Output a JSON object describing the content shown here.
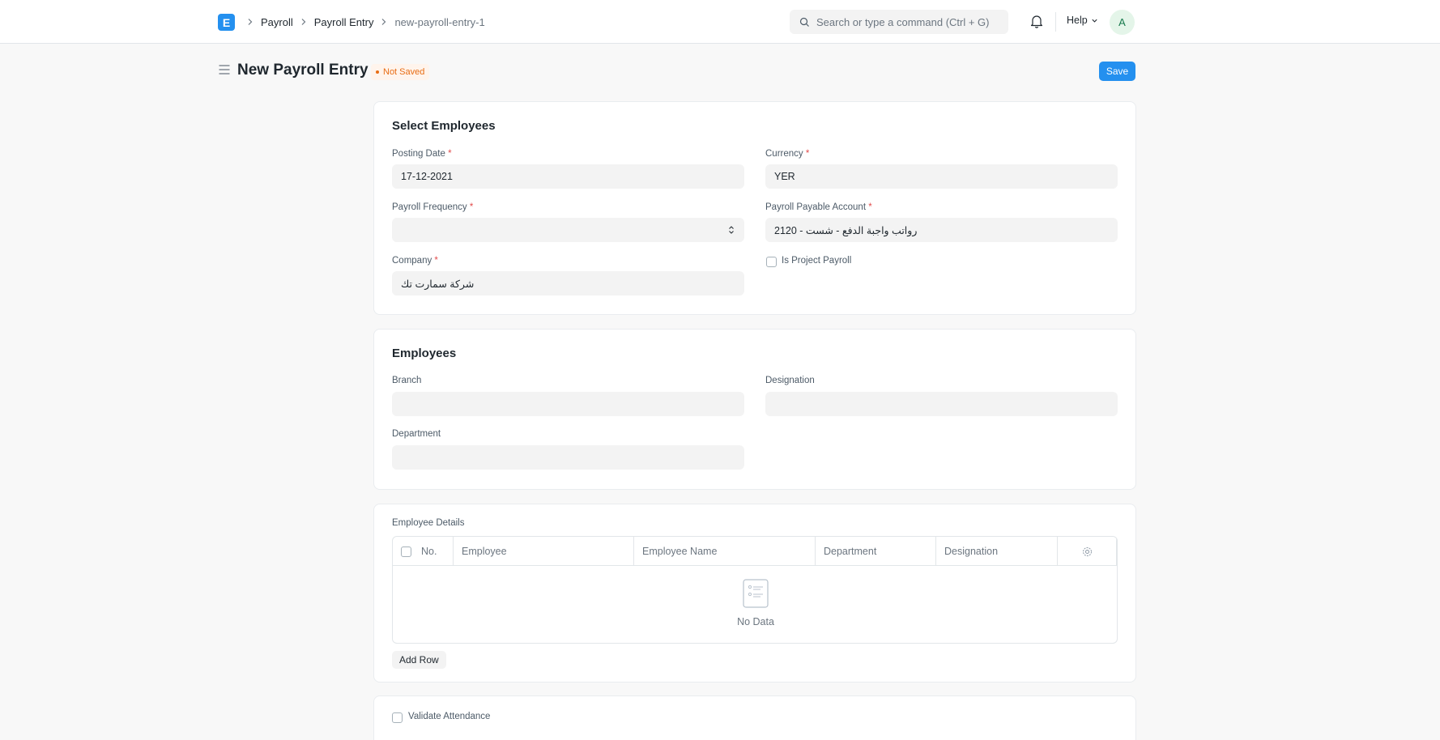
{
  "navbar": {
    "logo": "E",
    "breadcrumbs": [
      "Payroll",
      "Payroll Entry",
      "new-payroll-entry-1"
    ],
    "search_placeholder": "Search or type a command (Ctrl + G)",
    "help_label": "Help",
    "avatar_initial": "A"
  },
  "page": {
    "title": "New Payroll Entry",
    "status": "Not Saved",
    "save_label": "Save"
  },
  "select_employees": {
    "title": "Select Employees",
    "posting_date_label": "Posting Date",
    "posting_date_value": "17-12-2021",
    "currency_label": "Currency",
    "currency_value": "YER",
    "payroll_frequency_label": "Payroll Frequency",
    "payroll_frequency_value": "",
    "payable_account_label": "Payroll Payable Account",
    "payable_account_value": "2120 - رواتب واجبة الدفع - شست",
    "company_label": "Company",
    "company_value": "شركة سمارت تك",
    "is_project_payroll_label": "Is Project Payroll",
    "required_mark": "*"
  },
  "employees": {
    "title": "Employees",
    "branch_label": "Branch",
    "designation_label": "Designation",
    "department_label": "Department"
  },
  "employee_details": {
    "label": "Employee Details",
    "columns": [
      "No.",
      "Employee",
      "Employee Name",
      "Department",
      "Designation"
    ],
    "empty_text": "No Data",
    "add_row_label": "Add Row"
  },
  "validate": {
    "label": "Validate Attendance"
  },
  "colors": {
    "primary": "#2490ef",
    "not_saved": "#e86c13",
    "required": "#e24c4c"
  }
}
